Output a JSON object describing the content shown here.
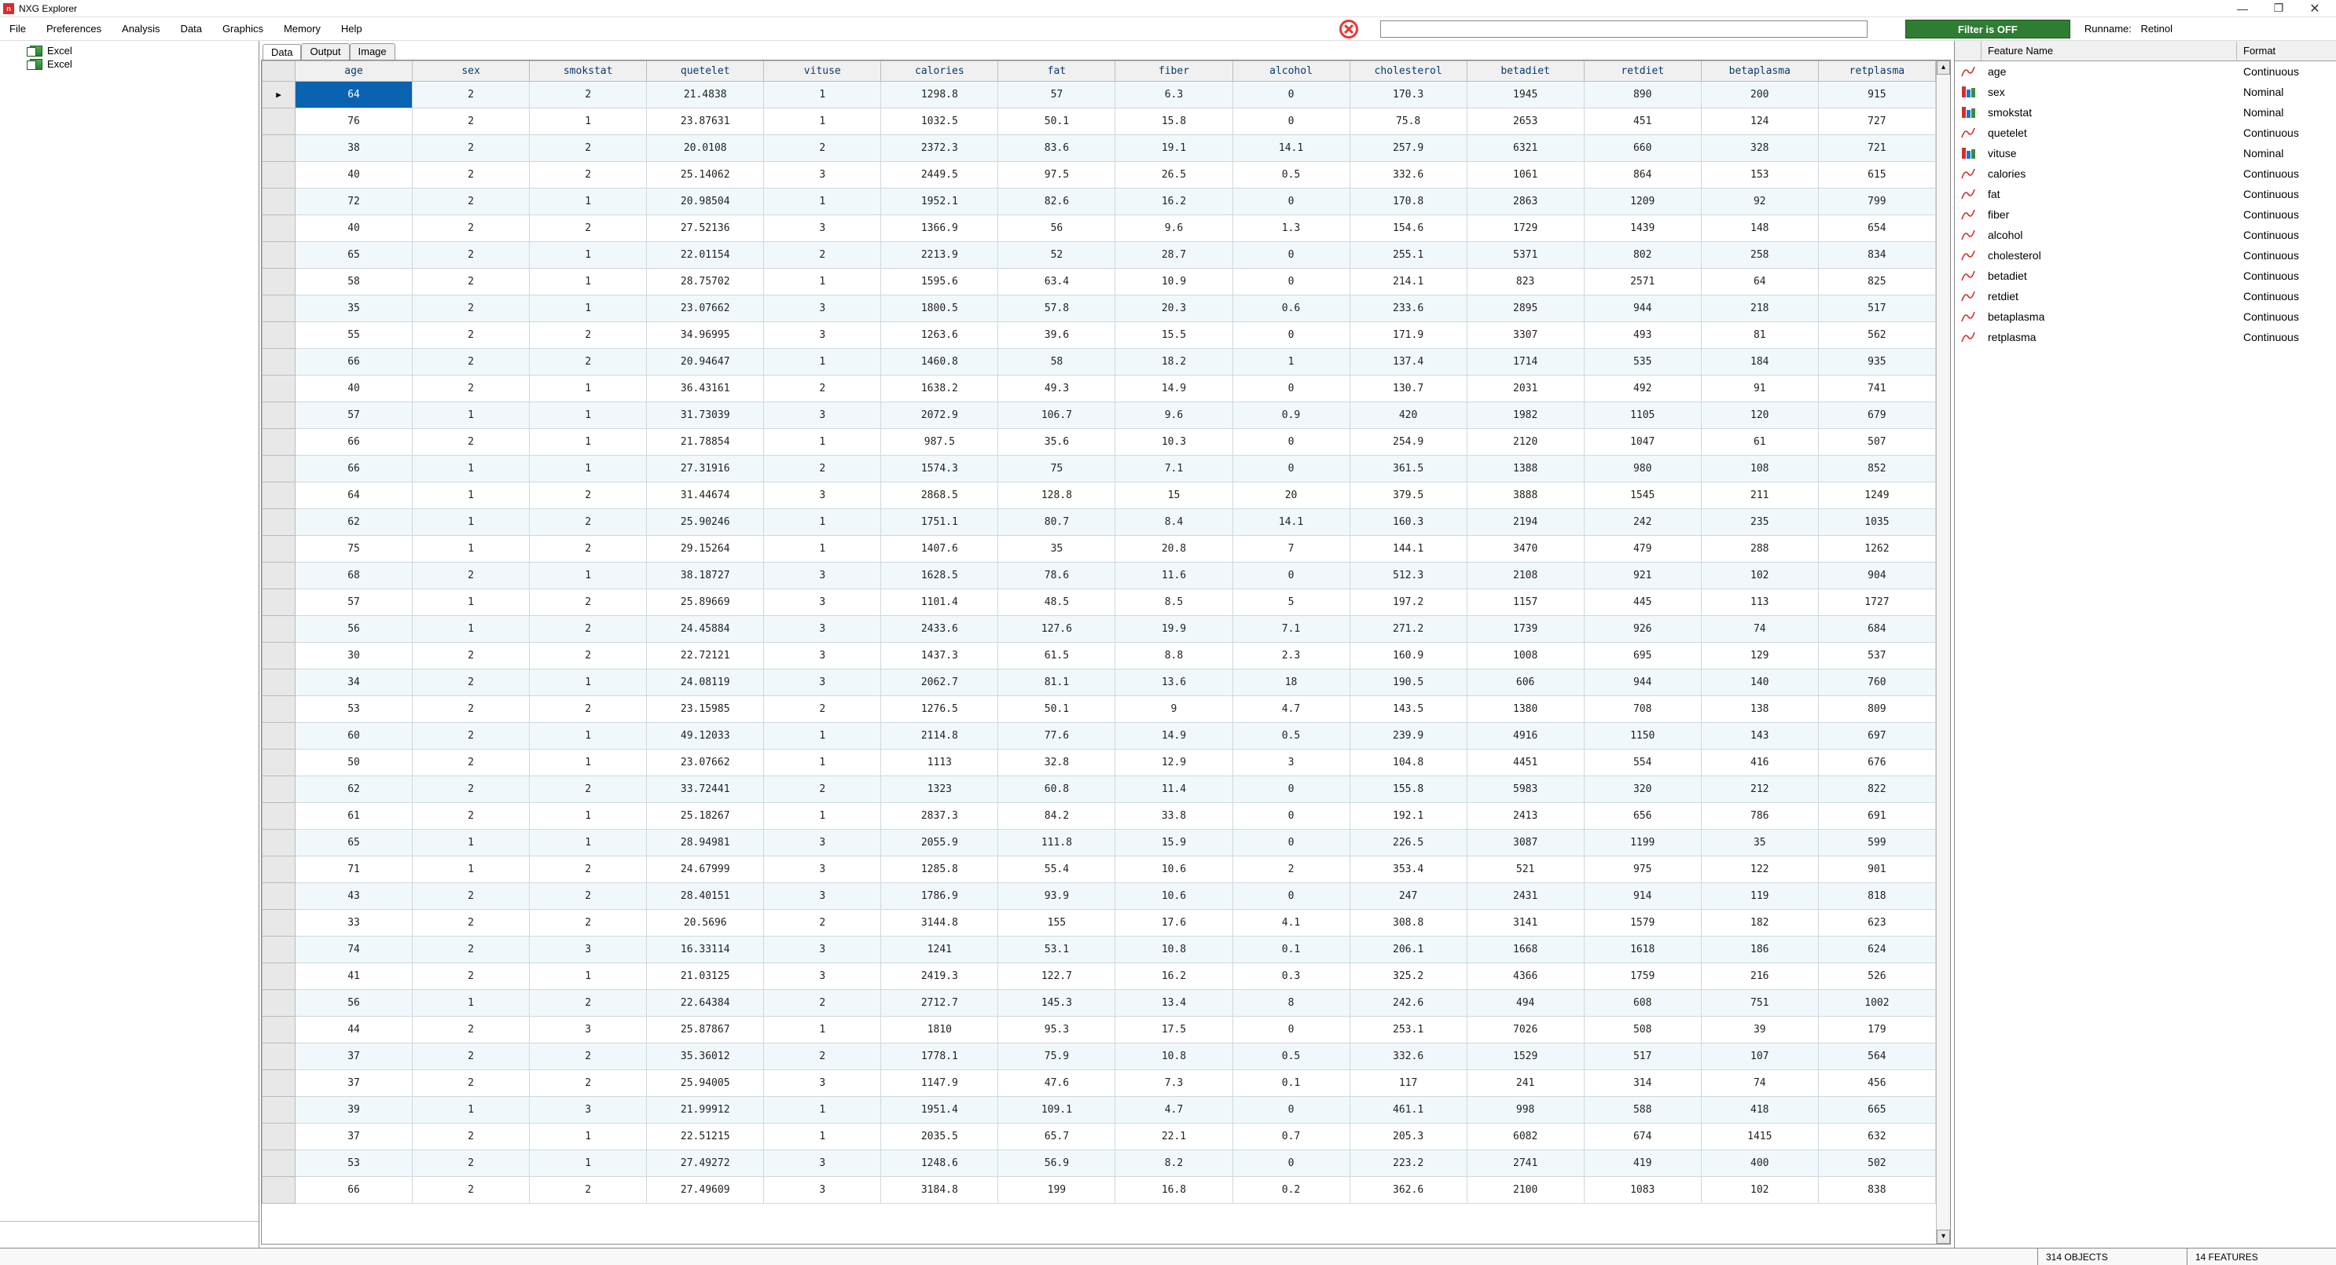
{
  "app": {
    "title": "NXG Explorer"
  },
  "menus": [
    "File",
    "Preferences",
    "Analysis",
    "Data",
    "Graphics",
    "Memory",
    "Help"
  ],
  "toolbar": {
    "search_value": "",
    "filter_button": "Filter is OFF",
    "runname_label": "Runname:",
    "runname_value": "Retinol"
  },
  "left_tree": {
    "items": [
      "Excel",
      "Excel"
    ]
  },
  "tabs": [
    "Data",
    "Output",
    "Image"
  ],
  "columns": [
    "age",
    "sex",
    "smokstat",
    "quetelet",
    "vituse",
    "calories",
    "fat",
    "fiber",
    "alcohol",
    "cholesterol",
    "betadiet",
    "retdiet",
    "betaplasma",
    "retplasma"
  ],
  "rows": [
    [
      "64",
      "2",
      "2",
      "21.4838",
      "1",
      "1298.8",
      "57",
      "6.3",
      "0",
      "170.3",
      "1945",
      "890",
      "200",
      "915"
    ],
    [
      "76",
      "2",
      "1",
      "23.87631",
      "1",
      "1032.5",
      "50.1",
      "15.8",
      "0",
      "75.8",
      "2653",
      "451",
      "124",
      "727"
    ],
    [
      "38",
      "2",
      "2",
      "20.0108",
      "2",
      "2372.3",
      "83.6",
      "19.1",
      "14.1",
      "257.9",
      "6321",
      "660",
      "328",
      "721"
    ],
    [
      "40",
      "2",
      "2",
      "25.14062",
      "3",
      "2449.5",
      "97.5",
      "26.5",
      "0.5",
      "332.6",
      "1061",
      "864",
      "153",
      "615"
    ],
    [
      "72",
      "2",
      "1",
      "20.98504",
      "1",
      "1952.1",
      "82.6",
      "16.2",
      "0",
      "170.8",
      "2863",
      "1209",
      "92",
      "799"
    ],
    [
      "40",
      "2",
      "2",
      "27.52136",
      "3",
      "1366.9",
      "56",
      "9.6",
      "1.3",
      "154.6",
      "1729",
      "1439",
      "148",
      "654"
    ],
    [
      "65",
      "2",
      "1",
      "22.01154",
      "2",
      "2213.9",
      "52",
      "28.7",
      "0",
      "255.1",
      "5371",
      "802",
      "258",
      "834"
    ],
    [
      "58",
      "2",
      "1",
      "28.75702",
      "1",
      "1595.6",
      "63.4",
      "10.9",
      "0",
      "214.1",
      "823",
      "2571",
      "64",
      "825"
    ],
    [
      "35",
      "2",
      "1",
      "23.07662",
      "3",
      "1800.5",
      "57.8",
      "20.3",
      "0.6",
      "233.6",
      "2895",
      "944",
      "218",
      "517"
    ],
    [
      "55",
      "2",
      "2",
      "34.96995",
      "3",
      "1263.6",
      "39.6",
      "15.5",
      "0",
      "171.9",
      "3307",
      "493",
      "81",
      "562"
    ],
    [
      "66",
      "2",
      "2",
      "20.94647",
      "1",
      "1460.8",
      "58",
      "18.2",
      "1",
      "137.4",
      "1714",
      "535",
      "184",
      "935"
    ],
    [
      "40",
      "2",
      "1",
      "36.43161",
      "2",
      "1638.2",
      "49.3",
      "14.9",
      "0",
      "130.7",
      "2031",
      "492",
      "91",
      "741"
    ],
    [
      "57",
      "1",
      "1",
      "31.73039",
      "3",
      "2072.9",
      "106.7",
      "9.6",
      "0.9",
      "420",
      "1982",
      "1105",
      "120",
      "679"
    ],
    [
      "66",
      "2",
      "1",
      "21.78854",
      "1",
      "987.5",
      "35.6",
      "10.3",
      "0",
      "254.9",
      "2120",
      "1047",
      "61",
      "507"
    ],
    [
      "66",
      "1",
      "1",
      "27.31916",
      "2",
      "1574.3",
      "75",
      "7.1",
      "0",
      "361.5",
      "1388",
      "980",
      "108",
      "852"
    ],
    [
      "64",
      "1",
      "2",
      "31.44674",
      "3",
      "2868.5",
      "128.8",
      "15",
      "20",
      "379.5",
      "3888",
      "1545",
      "211",
      "1249"
    ],
    [
      "62",
      "1",
      "2",
      "25.90246",
      "1",
      "1751.1",
      "80.7",
      "8.4",
      "14.1",
      "160.3",
      "2194",
      "242",
      "235",
      "1035"
    ],
    [
      "75",
      "1",
      "2",
      "29.15264",
      "1",
      "1407.6",
      "35",
      "20.8",
      "7",
      "144.1",
      "3470",
      "479",
      "288",
      "1262"
    ],
    [
      "68",
      "2",
      "1",
      "38.18727",
      "3",
      "1628.5",
      "78.6",
      "11.6",
      "0",
      "512.3",
      "2108",
      "921",
      "102",
      "904"
    ],
    [
      "57",
      "1",
      "2",
      "25.89669",
      "3",
      "1101.4",
      "48.5",
      "8.5",
      "5",
      "197.2",
      "1157",
      "445",
      "113",
      "1727"
    ],
    [
      "56",
      "1",
      "2",
      "24.45884",
      "3",
      "2433.6",
      "127.6",
      "19.9",
      "7.1",
      "271.2",
      "1739",
      "926",
      "74",
      "684"
    ],
    [
      "30",
      "2",
      "2",
      "22.72121",
      "3",
      "1437.3",
      "61.5",
      "8.8",
      "2.3",
      "160.9",
      "1008",
      "695",
      "129",
      "537"
    ],
    [
      "34",
      "2",
      "1",
      "24.08119",
      "3",
      "2062.7",
      "81.1",
      "13.6",
      "18",
      "190.5",
      "606",
      "944",
      "140",
      "760"
    ],
    [
      "53",
      "2",
      "2",
      "23.15985",
      "2",
      "1276.5",
      "50.1",
      "9",
      "4.7",
      "143.5",
      "1380",
      "708",
      "138",
      "809"
    ],
    [
      "60",
      "2",
      "1",
      "49.12033",
      "1",
      "2114.8",
      "77.6",
      "14.9",
      "0.5",
      "239.9",
      "4916",
      "1150",
      "143",
      "697"
    ],
    [
      "50",
      "2",
      "1",
      "23.07662",
      "1",
      "1113",
      "32.8",
      "12.9",
      "3",
      "104.8",
      "4451",
      "554",
      "416",
      "676"
    ],
    [
      "62",
      "2",
      "2",
      "33.72441",
      "2",
      "1323",
      "60.8",
      "11.4",
      "0",
      "155.8",
      "5983",
      "320",
      "212",
      "822"
    ],
    [
      "61",
      "2",
      "1",
      "25.18267",
      "1",
      "2837.3",
      "84.2",
      "33.8",
      "0",
      "192.1",
      "2413",
      "656",
      "786",
      "691"
    ],
    [
      "65",
      "1",
      "1",
      "28.94981",
      "3",
      "2055.9",
      "111.8",
      "15.9",
      "0",
      "226.5",
      "3087",
      "1199",
      "35",
      "599"
    ],
    [
      "71",
      "1",
      "2",
      "24.67999",
      "3",
      "1285.8",
      "55.4",
      "10.6",
      "2",
      "353.4",
      "521",
      "975",
      "122",
      "901"
    ],
    [
      "43",
      "2",
      "2",
      "28.40151",
      "3",
      "1786.9",
      "93.9",
      "10.6",
      "0",
      "247",
      "2431",
      "914",
      "119",
      "818"
    ],
    [
      "33",
      "2",
      "2",
      "20.5696",
      "2",
      "3144.8",
      "155",
      "17.6",
      "4.1",
      "308.8",
      "3141",
      "1579",
      "182",
      "623"
    ],
    [
      "74",
      "2",
      "3",
      "16.33114",
      "3",
      "1241",
      "53.1",
      "10.8",
      "0.1",
      "206.1",
      "1668",
      "1618",
      "186",
      "624"
    ],
    [
      "41",
      "2",
      "1",
      "21.03125",
      "3",
      "2419.3",
      "122.7",
      "16.2",
      "0.3",
      "325.2",
      "4366",
      "1759",
      "216",
      "526"
    ],
    [
      "56",
      "1",
      "2",
      "22.64384",
      "2",
      "2712.7",
      "145.3",
      "13.4",
      "8",
      "242.6",
      "494",
      "608",
      "751",
      "1002"
    ],
    [
      "44",
      "2",
      "3",
      "25.87867",
      "1",
      "1810",
      "95.3",
      "17.5",
      "0",
      "253.1",
      "7026",
      "508",
      "39",
      "179"
    ],
    [
      "37",
      "2",
      "2",
      "35.36012",
      "2",
      "1778.1",
      "75.9",
      "10.8",
      "0.5",
      "332.6",
      "1529",
      "517",
      "107",
      "564"
    ],
    [
      "37",
      "2",
      "2",
      "25.94005",
      "3",
      "1147.9",
      "47.6",
      "7.3",
      "0.1",
      "117",
      "241",
      "314",
      "74",
      "456"
    ],
    [
      "39",
      "1",
      "3",
      "21.99912",
      "1",
      "1951.4",
      "109.1",
      "4.7",
      "0",
      "461.1",
      "998",
      "588",
      "418",
      "665"
    ],
    [
      "37",
      "2",
      "1",
      "22.51215",
      "1",
      "2035.5",
      "65.7",
      "22.1",
      "0.7",
      "205.3",
      "6082",
      "674",
      "1415",
      "632"
    ],
    [
      "53",
      "2",
      "1",
      "27.49272",
      "3",
      "1248.6",
      "56.9",
      "8.2",
      "0",
      "223.2",
      "2741",
      "419",
      "400",
      "502"
    ],
    [
      "66",
      "2",
      "2",
      "27.49609",
      "3",
      "3184.8",
      "199",
      "16.8",
      "0.2",
      "362.6",
      "2100",
      "1083",
      "102",
      "838"
    ]
  ],
  "features": [
    {
      "name": "age",
      "format": "Continuous",
      "type": "cont"
    },
    {
      "name": "sex",
      "format": "Nominal",
      "type": "nom"
    },
    {
      "name": "smokstat",
      "format": "Nominal",
      "type": "nom"
    },
    {
      "name": "quetelet",
      "format": "Continuous",
      "type": "cont"
    },
    {
      "name": "vituse",
      "format": "Nominal",
      "type": "nom"
    },
    {
      "name": "calories",
      "format": "Continuous",
      "type": "cont"
    },
    {
      "name": "fat",
      "format": "Continuous",
      "type": "cont"
    },
    {
      "name": "fiber",
      "format": "Continuous",
      "type": "cont"
    },
    {
      "name": "alcohol",
      "format": "Continuous",
      "type": "cont"
    },
    {
      "name": "cholesterol",
      "format": "Continuous",
      "type": "cont"
    },
    {
      "name": "betadiet",
      "format": "Continuous",
      "type": "cont"
    },
    {
      "name": "retdiet",
      "format": "Continuous",
      "type": "cont"
    },
    {
      "name": "betaplasma",
      "format": "Continuous",
      "type": "cont"
    },
    {
      "name": "retplasma",
      "format": "Continuous",
      "type": "cont"
    }
  ],
  "feature_panel": {
    "col_name": "Feature Name",
    "col_format": "Format"
  },
  "status": {
    "objects": "314 OBJECTS",
    "features": "14 FEATURES"
  }
}
